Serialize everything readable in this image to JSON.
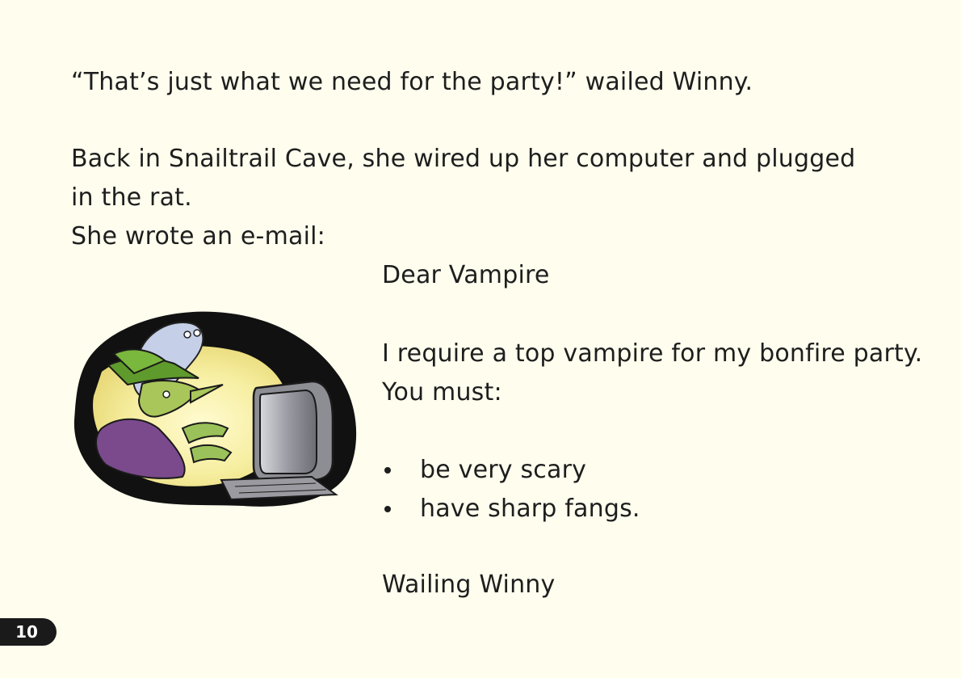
{
  "story": {
    "para1": "“That’s just what we need for the party!” wailed Winny.",
    "para2_line1": "Back in Snailtrail Cave, she wired up her computer and plugged",
    "para2_line2": "in the rat.",
    "para3": "She wrote an e-mail:"
  },
  "email": {
    "greeting": "Dear Vampire",
    "body_line1": "I require a top vampire for my bonfire party.",
    "body_line2": "You must:",
    "bullets": [
      "be very scary",
      "have sharp fangs."
    ],
    "signature": "Wailing Winny"
  },
  "page": {
    "number": "10"
  }
}
